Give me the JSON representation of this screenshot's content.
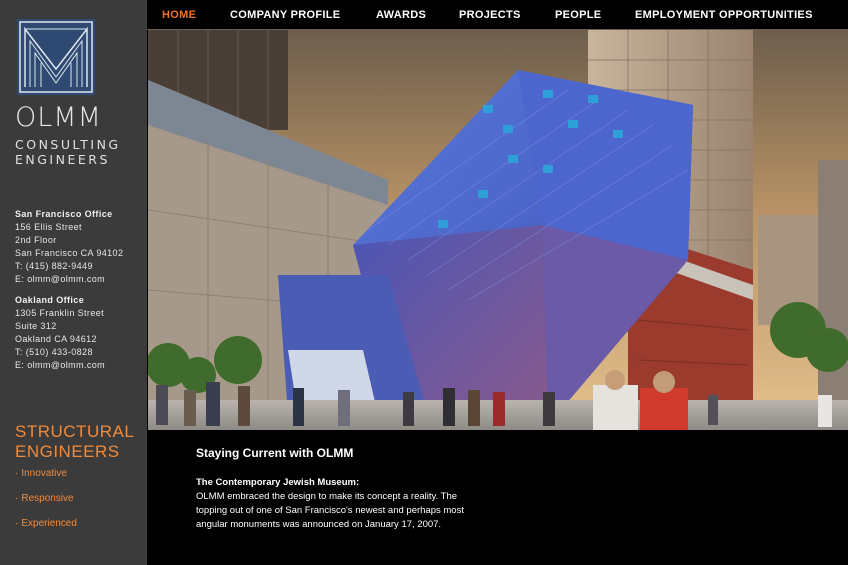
{
  "brand": {
    "name": "OLMM",
    "sub_line1": "CONSULTING",
    "sub_line2": "ENGINEERS"
  },
  "offices": {
    "sf": {
      "name": "San Francisco Office",
      "street": "156 Ellis Street",
      "floor": "2nd Floor",
      "city": "San Francisco CA 94102",
      "phone": "T: (415) 882-9449",
      "email": "E: olmm@olmm.com"
    },
    "oak": {
      "name": "Oakland Office",
      "street": "1305 Franklin Street",
      "suite": "Suite 312",
      "city": "Oakland CA 94612",
      "phone": "T: (510) 433-0828",
      "email": "E: olmm@olmm.com"
    }
  },
  "tagline": {
    "line1": "STRUCTURAL",
    "line2": "ENGINEERS",
    "bullet": "·",
    "items": [
      "Innovative",
      "Responsive",
      "Experienced"
    ]
  },
  "nav": {
    "items": [
      "HOME",
      "COMPANY PROFILE",
      "AWARDS",
      "PROJECTS",
      "PEOPLE",
      "EMPLOYMENT OPPORTUNITIES"
    ],
    "active": "HOME"
  },
  "main": {
    "heading": "Staying Current with OLMM",
    "article_title": "The Contemporary Jewish Museum:",
    "article_body": "OLMM embraced the design to make its concept a reality. The topping out of one of San Francisco's newest and perhaps most angular monuments was announced on January 17, 2007."
  },
  "colors": {
    "sidebar_bg": "#3b3b3b",
    "accent": "#f08a3c",
    "nav_active": "#e8752a",
    "logo_blue": "#2e4a72"
  }
}
